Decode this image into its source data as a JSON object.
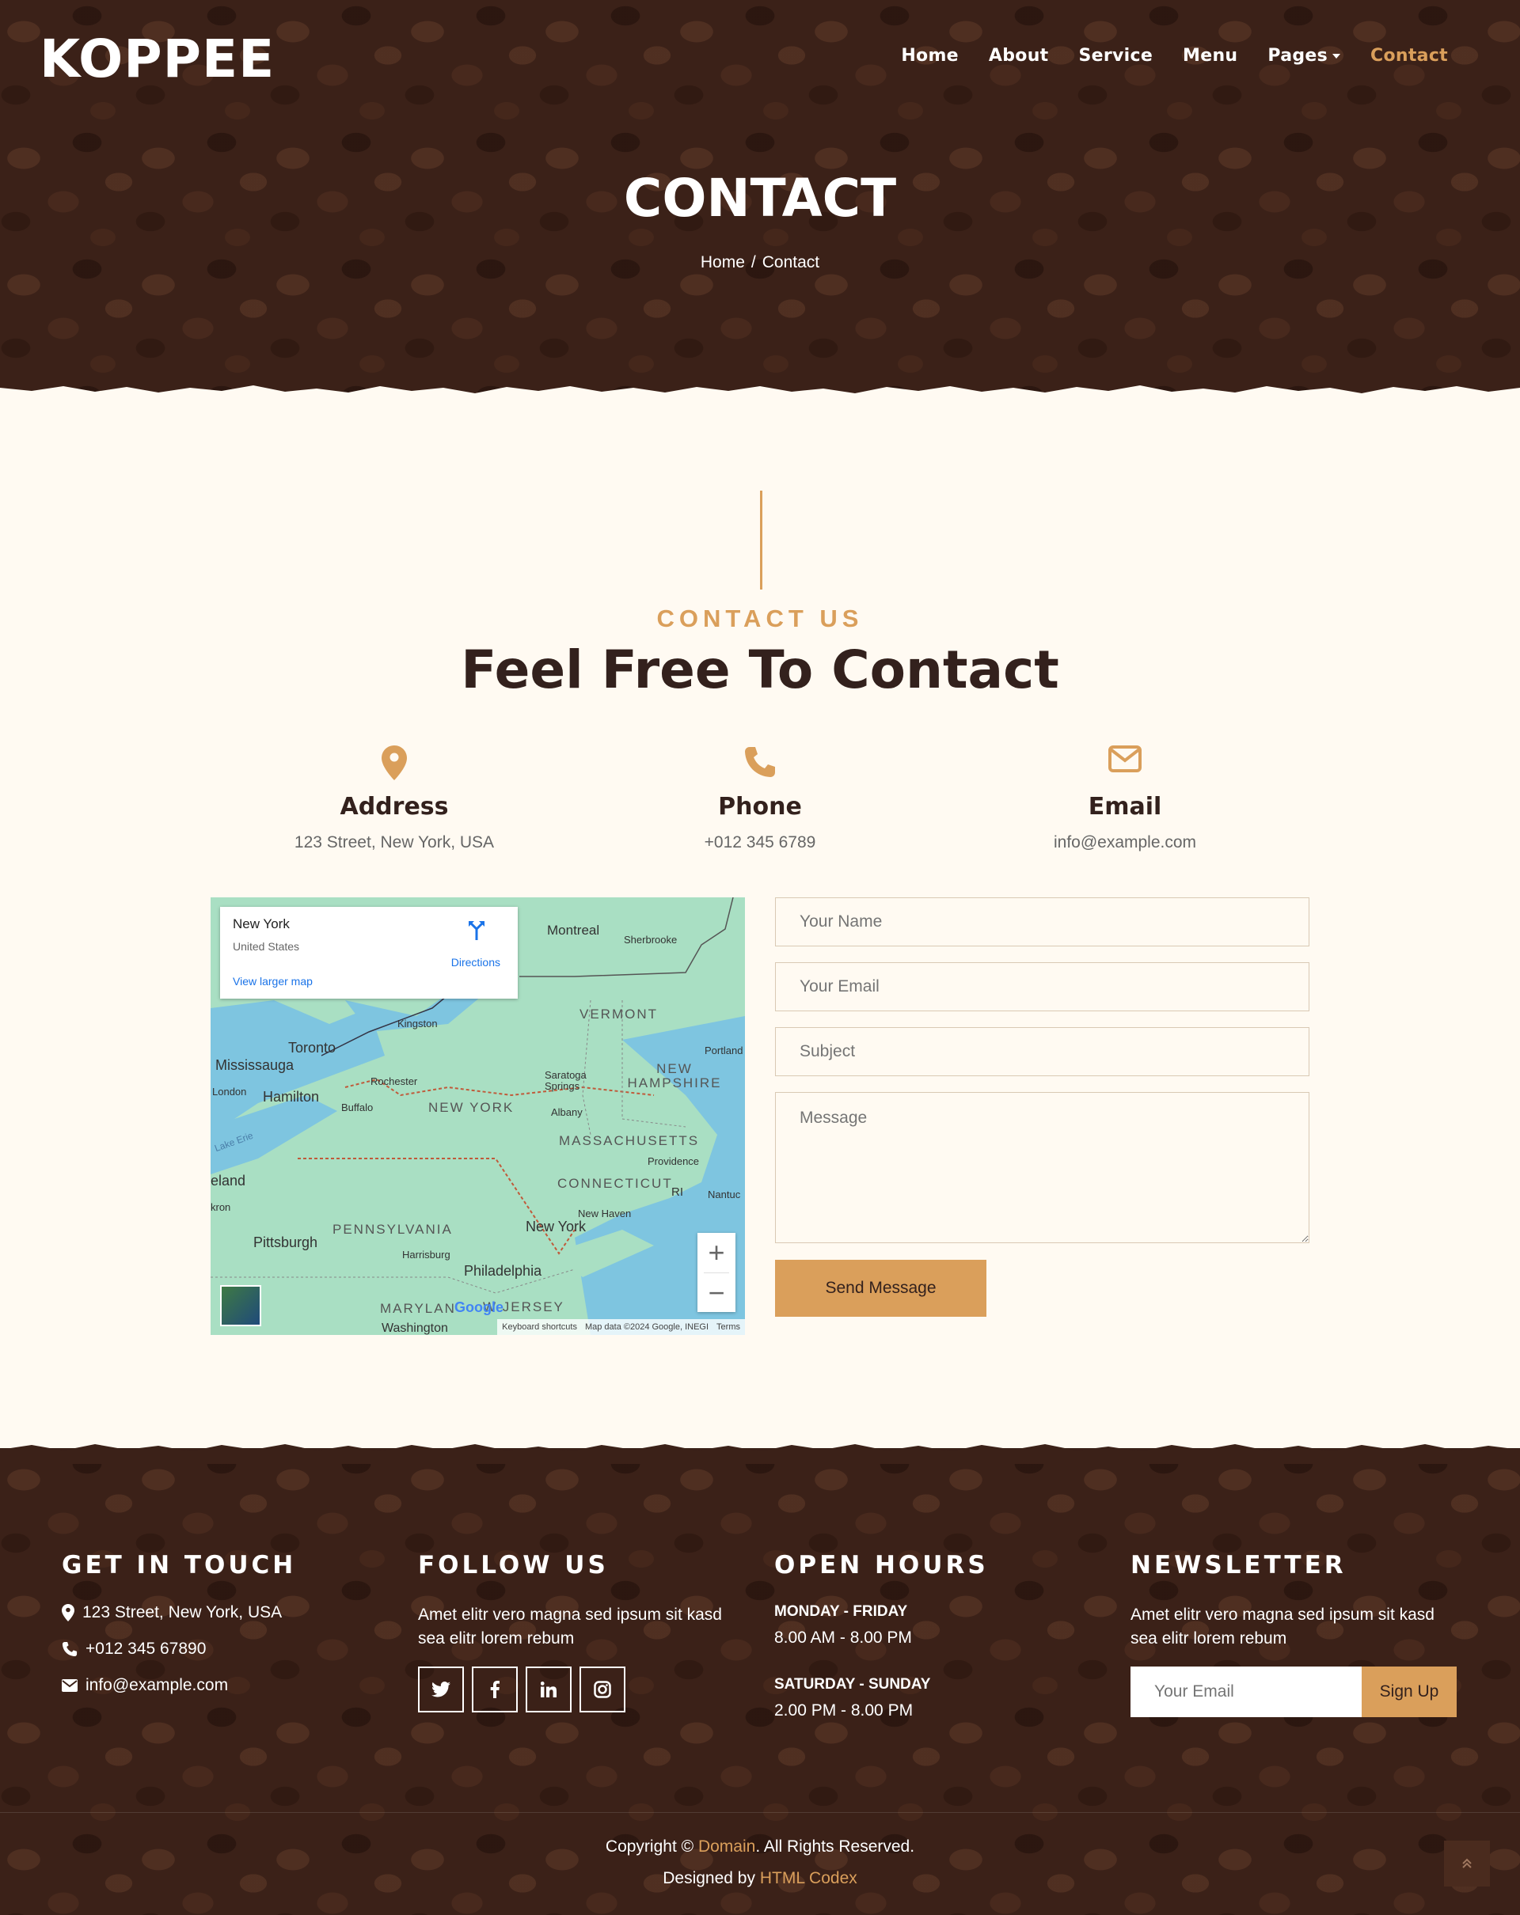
{
  "brand": "KOPPEE",
  "nav": {
    "home": "Home",
    "about": "About",
    "service": "Service",
    "menu": "Menu",
    "pages": "Pages",
    "contact": "Contact"
  },
  "hero": {
    "title": "CONTACT",
    "crumb_home": "Home",
    "crumb_sep": "/",
    "crumb_current": "Contact"
  },
  "section": {
    "subtitle": "CONTACT US",
    "title": "Feel Free To Contact"
  },
  "info": [
    {
      "title": "Address",
      "value": "123 Street, New York, USA",
      "icon": "map-marker-icon"
    },
    {
      "title": "Phone",
      "value": "+012 345 6789",
      "icon": "phone-icon"
    },
    {
      "title": "Email",
      "value": "info@example.com",
      "icon": "envelope-icon"
    }
  ],
  "map": {
    "place": "New York",
    "country": "United States",
    "directions": "Directions",
    "larger_map": "View larger map",
    "zoom_in": "+",
    "zoom_out": "−",
    "google": "Google",
    "shortcuts": "Keyboard shortcuts",
    "data": "Map data ©2024 Google, INEGI",
    "terms": "Terms",
    "labels": {
      "montreal": "Montreal",
      "sherbrooke": "Sherbrooke",
      "vermont": "VERMONT",
      "kingston": "Kingston",
      "toronto": "Toronto",
      "mississauga": "Mississauga",
      "london": "London",
      "hamilton": "Hamilton",
      "rochester": "Rochester",
      "buffalo": "Buffalo",
      "new_york_state": "NEW YORK",
      "saratoga": "Saratoga Springs",
      "albany": "Albany",
      "new_hampshire": "NEW HAMPSHIRE",
      "portland": "Portland",
      "massachusetts": "MASSACHUSETTS",
      "providence": "Providence",
      "lake_erie": "Lake Erie",
      "cleveland": "eland",
      "akron": "kron",
      "connecticut": "CONNECTICUT",
      "ri": "RI",
      "nantucket": "Nantuc",
      "new_haven": "New Haven",
      "new_york_city": "New York",
      "pennsylvania": "PENNSYLVANIA",
      "pittsburgh": "Pittsburgh",
      "harrisburg": "Harrisburg",
      "philadelphia": "Philadelphia",
      "maryland": "MARYLAN",
      "new_jersey": "W JERSEY",
      "washington": "Washington"
    }
  },
  "form": {
    "name_placeholder": "Your Name",
    "email_placeholder": "Your Email",
    "subject_placeholder": "Subject",
    "message_placeholder": "Message",
    "send_label": "Send Message"
  },
  "footer": {
    "touch_title": "GET IN TOUCH",
    "address": "123 Street, New York, USA",
    "phone": "+012 345 67890",
    "email": "info@example.com",
    "follow_title": "FOLLOW US",
    "follow_text": "Amet elitr vero magna sed ipsum sit kasd sea elitr lorem rebum",
    "social": [
      "twitter-icon",
      "facebook-icon",
      "linkedin-icon",
      "instagram-icon"
    ],
    "hours_title": "OPEN HOURS",
    "weekday_label": "MONDAY - FRIDAY",
    "weekday_hours": "8.00 AM - 8.00 PM",
    "weekend_label": "SATURDAY - SUNDAY",
    "weekend_hours": "2.00 PM - 8.00 PM",
    "newsletter_title": "NEWSLETTER",
    "newsletter_text": "Amet elitr vero magna sed ipsum sit kasd sea elitr lorem rebum",
    "newsletter_placeholder": "Your Email",
    "signup_label": "Sign Up",
    "copyright_prefix": "Copyright ©",
    "copyright_link": "Domain",
    "copyright_suffix": ". All Rights Reserved.",
    "designed_prefix": "Designed by",
    "designed_link": "HTML Codex"
  },
  "colors": {
    "accent": "#da9f5b",
    "dark": "#33211d",
    "cream": "#fffaf2"
  }
}
